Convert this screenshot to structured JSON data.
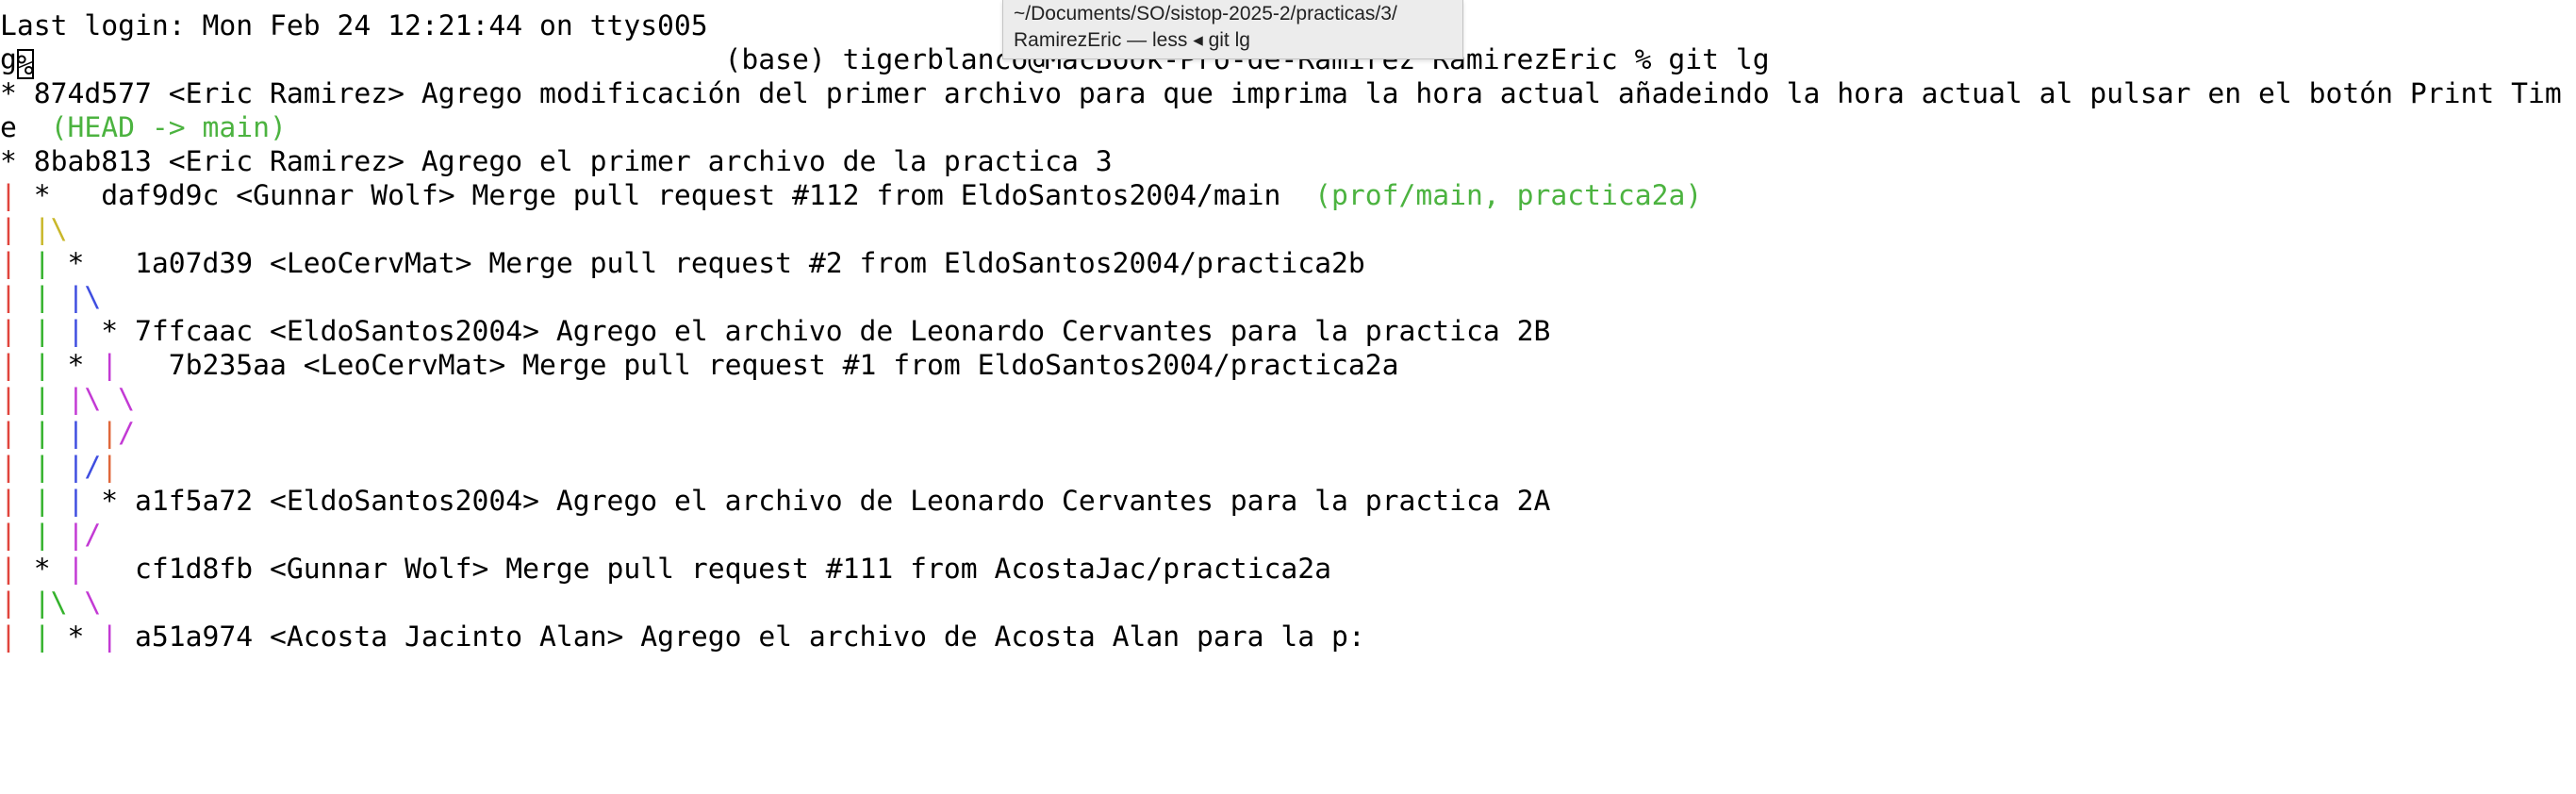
{
  "window": {
    "tooltip_line1": "~/Documents/SO/sistop-2025-2/practicas/3/",
    "tooltip_line2": "RamirezEric — less ◂ git lg"
  },
  "colors": {
    "text": "#000000",
    "background": "#ffffff",
    "ref_green": "#4cb340",
    "graph_red": "#e0443c",
    "graph_green": "#34b22c",
    "graph_yellow": "#c9b72a",
    "graph_blue": "#3f4ee0",
    "graph_magenta": "#c33ad4",
    "graph_orange": "#e0683c"
  },
  "terminal": {
    "lines": [
      [
        {
          "t": "Last login: Mon Feb 24 12:21:44 on ttys005"
        }
      ],
      [
        {
          "t": "g"
        },
        {
          "t": "%",
          "cursor": true
        },
        {
          "t": "                                         (base) tigerblanco@MacBook-Pro-de-Ramirez RamirezEric % git lg"
        }
      ],
      [
        {
          "t": "* 874d577 <Eric Ramirez> Agrego modificación del primer archivo para que imprima la hora actual añadeindo la hora actual al pulsar en el botón Print Tim"
        }
      ],
      [
        {
          "t": "e  "
        },
        {
          "t": "(HEAD -> main)",
          "c": "ref_green"
        }
      ],
      [
        {
          "t": "* 8bab813 <Eric Ramirez> Agrego el primer archivo de la practica 3"
        }
      ],
      [
        {
          "t": "|",
          "c": "graph_red"
        },
        {
          "t": " *   daf9d9c <Gunnar Wolf> Merge pull request #112 from EldoSantos2004/main  "
        },
        {
          "t": "(prof/main, practica2a)",
          "c": "ref_green"
        }
      ],
      [
        {
          "t": "|",
          "c": "graph_red"
        },
        {
          "t": " "
        },
        {
          "t": "|\\",
          "c": "graph_yellow"
        }
      ],
      [
        {
          "t": "|",
          "c": "graph_red"
        },
        {
          "t": " "
        },
        {
          "t": "|",
          "c": "graph_green"
        },
        {
          "t": " *   1a07d39 <LeoCervMat> Merge pull request #2 from EldoSantos2004/practica2b"
        }
      ],
      [
        {
          "t": "|",
          "c": "graph_red"
        },
        {
          "t": " "
        },
        {
          "t": "|",
          "c": "graph_green"
        },
        {
          "t": " "
        },
        {
          "t": "|\\",
          "c": "graph_blue"
        }
      ],
      [
        {
          "t": "|",
          "c": "graph_red"
        },
        {
          "t": " "
        },
        {
          "t": "|",
          "c": "graph_green"
        },
        {
          "t": " "
        },
        {
          "t": "|",
          "c": "graph_blue"
        },
        {
          "t": " * 7ffcaac <EldoSantos2004> Agrego el archivo de Leonardo Cervantes para la practica 2B"
        }
      ],
      [
        {
          "t": "|",
          "c": "graph_red"
        },
        {
          "t": " "
        },
        {
          "t": "|",
          "c": "graph_green"
        },
        {
          "t": " * "
        },
        {
          "t": "|",
          "c": "graph_magenta"
        },
        {
          "t": "   7b235aa <LeoCervMat> Merge pull request #1 from EldoSantos2004/practica2a"
        }
      ],
      [
        {
          "t": "|",
          "c": "graph_red"
        },
        {
          "t": " "
        },
        {
          "t": "|",
          "c": "graph_green"
        },
        {
          "t": " "
        },
        {
          "t": "|\\ \\",
          "c": "graph_magenta"
        }
      ],
      [
        {
          "t": "|",
          "c": "graph_red"
        },
        {
          "t": " "
        },
        {
          "t": "|",
          "c": "graph_green"
        },
        {
          "t": " "
        },
        {
          "t": "|",
          "c": "graph_blue"
        },
        {
          "t": " "
        },
        {
          "t": "|",
          "c": "graph_orange"
        },
        {
          "t": "/",
          "c": "graph_magenta"
        }
      ],
      [
        {
          "t": "|",
          "c": "graph_red"
        },
        {
          "t": " "
        },
        {
          "t": "|",
          "c": "graph_green"
        },
        {
          "t": " "
        },
        {
          "t": "|/",
          "c": "graph_blue"
        },
        {
          "t": "|",
          "c": "graph_orange"
        }
      ],
      [
        {
          "t": "|",
          "c": "graph_red"
        },
        {
          "t": " "
        },
        {
          "t": "|",
          "c": "graph_green"
        },
        {
          "t": " "
        },
        {
          "t": "|",
          "c": "graph_blue"
        },
        {
          "t": " * a1f5a72 <EldoSantos2004> Agrego el archivo de Leonardo Cervantes para la practica 2A"
        }
      ],
      [
        {
          "t": "|",
          "c": "graph_red"
        },
        {
          "t": " "
        },
        {
          "t": "|",
          "c": "graph_green"
        },
        {
          "t": " "
        },
        {
          "t": "|/",
          "c": "graph_magenta"
        }
      ],
      [
        {
          "t": "|",
          "c": "graph_red"
        },
        {
          "t": " * "
        },
        {
          "t": "|",
          "c": "graph_magenta"
        },
        {
          "t": "   cf1d8fb <Gunnar Wolf> Merge pull request #111 from AcostaJac/practica2a"
        }
      ],
      [
        {
          "t": "|",
          "c": "graph_red"
        },
        {
          "t": " "
        },
        {
          "t": "|\\",
          "c": "graph_green"
        },
        {
          "t": " \\",
          "c": "graph_magenta"
        }
      ],
      [
        {
          "t": "|",
          "c": "graph_red"
        },
        {
          "t": " "
        },
        {
          "t": "|",
          "c": "graph_green"
        },
        {
          "t": " * "
        },
        {
          "t": "|",
          "c": "graph_magenta"
        },
        {
          "t": " a51a974 <Acosta Jacinto Alan> Agrego el archivo de Acosta Alan para la p:"
        }
      ]
    ]
  }
}
